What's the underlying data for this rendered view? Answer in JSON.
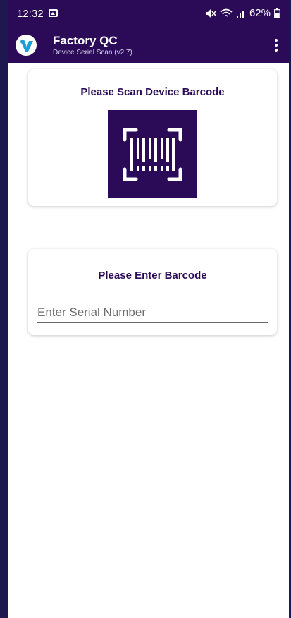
{
  "status_bar": {
    "time": "12:32",
    "battery_percent": "62%"
  },
  "app_bar": {
    "title": "Factory QC",
    "subtitle": "Device Serial Scan (v2.7)"
  },
  "scan_card": {
    "heading": "Please Scan Device Barcode"
  },
  "enter_card": {
    "heading": "Please Enter Barcode",
    "input_value": "",
    "input_placeholder": "Enter Serial Number"
  },
  "colors": {
    "primary": "#2b0b57",
    "logo_accent": "#1a9fd9"
  },
  "icons": [
    "image-icon",
    "mute-icon",
    "wifi-icon",
    "signal-icon",
    "battery-icon",
    "app-logo-icon",
    "more-vert-icon",
    "barcode-scan-icon"
  ]
}
